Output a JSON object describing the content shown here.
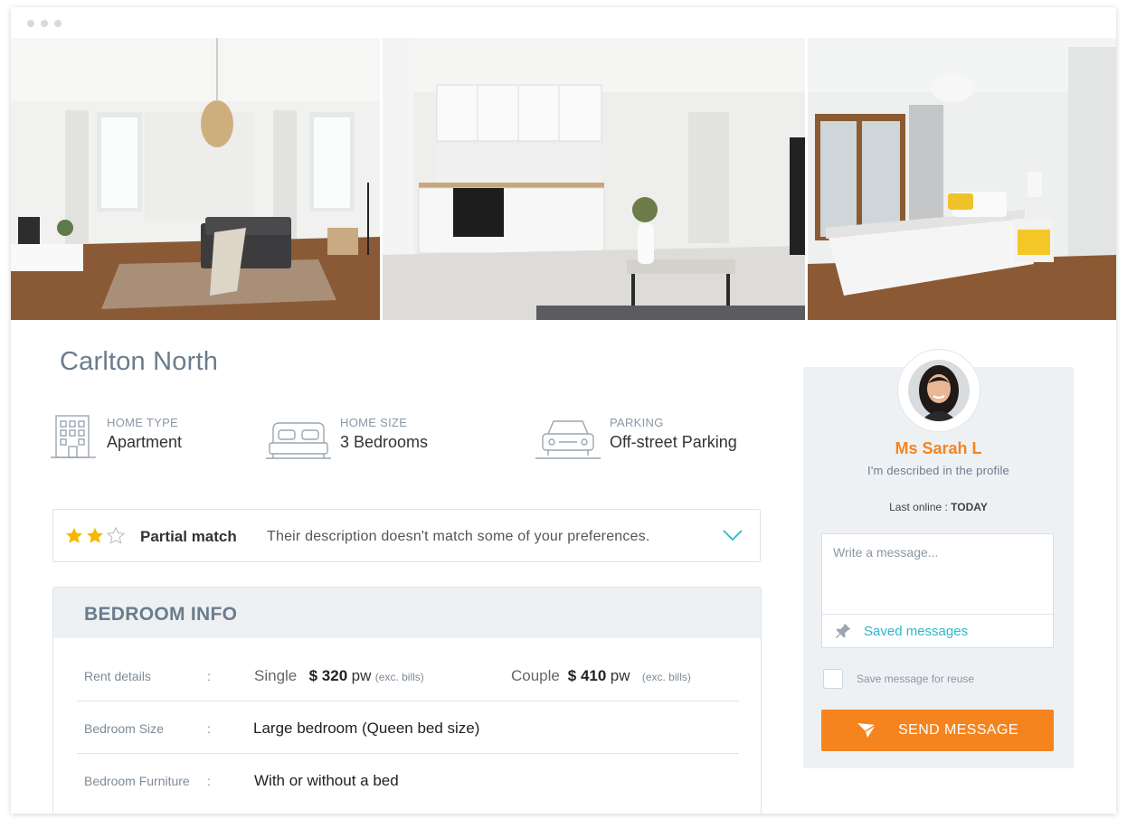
{
  "window": {
    "controls": [
      "dot",
      "dot",
      "dot"
    ]
  },
  "gallery": {
    "photos": [
      "living-room-photo",
      "kitchen-photo",
      "bedroom-photo"
    ]
  },
  "listing": {
    "title": "Carlton North"
  },
  "features": [
    {
      "icon": "building-icon",
      "label": "HOME TYPE",
      "value": "Apartment"
    },
    {
      "icon": "bed-icon",
      "label": "HOME SIZE",
      "value": "3 Bedrooms"
    },
    {
      "icon": "car-icon",
      "label": "PARKING",
      "value": "Off-street Parking"
    }
  ],
  "match": {
    "rating": 2,
    "max_rating": 3,
    "label": "Partial match",
    "description": "Their description doesn't match some of your preferences.",
    "star_color": "#f5b800"
  },
  "bedroom": {
    "heading": "BEDROOM INFO",
    "rows": {
      "rent": {
        "label": "Rent details",
        "colon": ":",
        "single": {
          "type": "Single",
          "price": "$ 320",
          "unit": "pw",
          "note": "(exc. bills)"
        },
        "couple": {
          "type": "Couple",
          "price": "$ 410",
          "unit": "pw",
          "note": "(exc. bills)"
        }
      },
      "size": {
        "label": "Bedroom Size",
        "colon": ":",
        "value": "Large bedroom (Queen bed size)"
      },
      "furniture": {
        "label": "Bedroom Furniture",
        "colon": ":",
        "value": "With or without a bed"
      }
    }
  },
  "contact": {
    "name": "Ms Sarah L",
    "subtitle": "I'm described in the profile",
    "online_label": "Last online : ",
    "online_value": "TODAY",
    "message_placeholder": "Write a message...",
    "saved_messages": "Saved messages",
    "save_reuse": "Save message for reuse",
    "send": "SEND MESSAGE",
    "accent": "#f5841f",
    "link_color": "#2cb9c9"
  }
}
